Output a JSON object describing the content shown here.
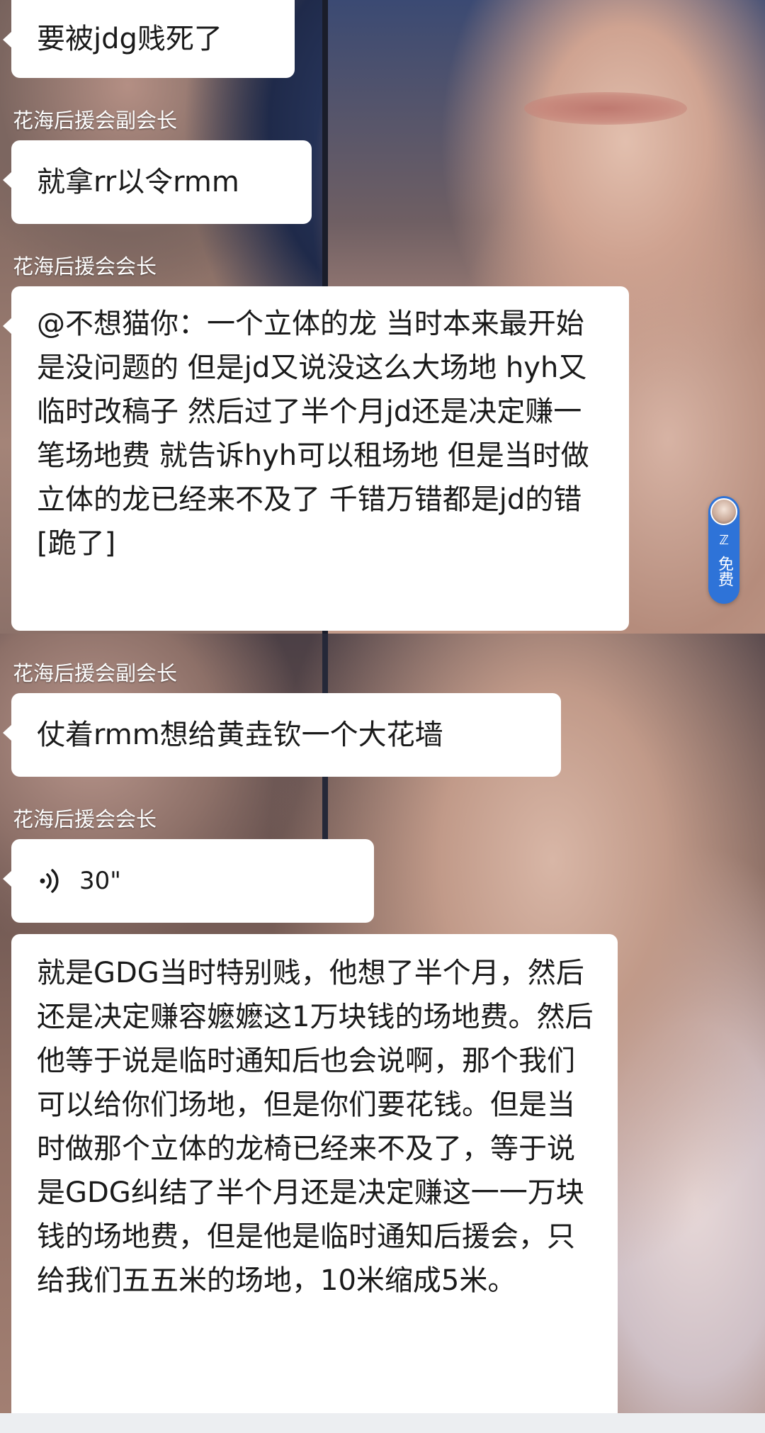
{
  "messages": [
    {
      "sender": "",
      "text": "要被jdg贱死了",
      "type": "text"
    },
    {
      "sender": "花海后援会副会长",
      "text": "就拿rr以令rmm",
      "type": "text"
    },
    {
      "sender": "花海后援会会长",
      "text": "@不想猫你：一个立体的龙 当时本来最开始是没问题的 但是jd又说没这么大场地 hyh又临时改稿子 然后过了半个月jd还是决定赚一笔场地费 就告诉hyh可以租场地 但是当时做立体的龙已经来不及了 千错万错都是jd的错[跪了]",
      "type": "text"
    },
    {
      "sender": "花海后援会副会长",
      "text": "仗着rmm想给黄垚钦一个大花墙",
      "type": "text"
    },
    {
      "sender": "花海后援会会长",
      "duration": "30\"",
      "type": "voice",
      "icon": "voice-wave-icon"
    },
    {
      "sender": "",
      "text": "就是GDG当时特别贱，他想了半个月，然后还是决定赚容嬷嬷这1万块钱的场地费。然后他等于说是临时通知后也会说啊，那个我们可以给你们场地，但是你们要花钱。但是当时做那个立体的龙椅已经来不及了，等于说是GDG纠结了半个月还是决定赚这一一万块钱的场地费，但是他是临时通知后援会，只给我们五五米的场地，10米缩成5米。",
      "type": "text"
    }
  ],
  "free_badge": {
    "mark": "ℤ",
    "label": "免费",
    "accent": "#2e73d8"
  },
  "colors": {
    "bubble": "#ffffff",
    "sender_text": "#ffffff",
    "message_text": "#1a1a1a"
  }
}
